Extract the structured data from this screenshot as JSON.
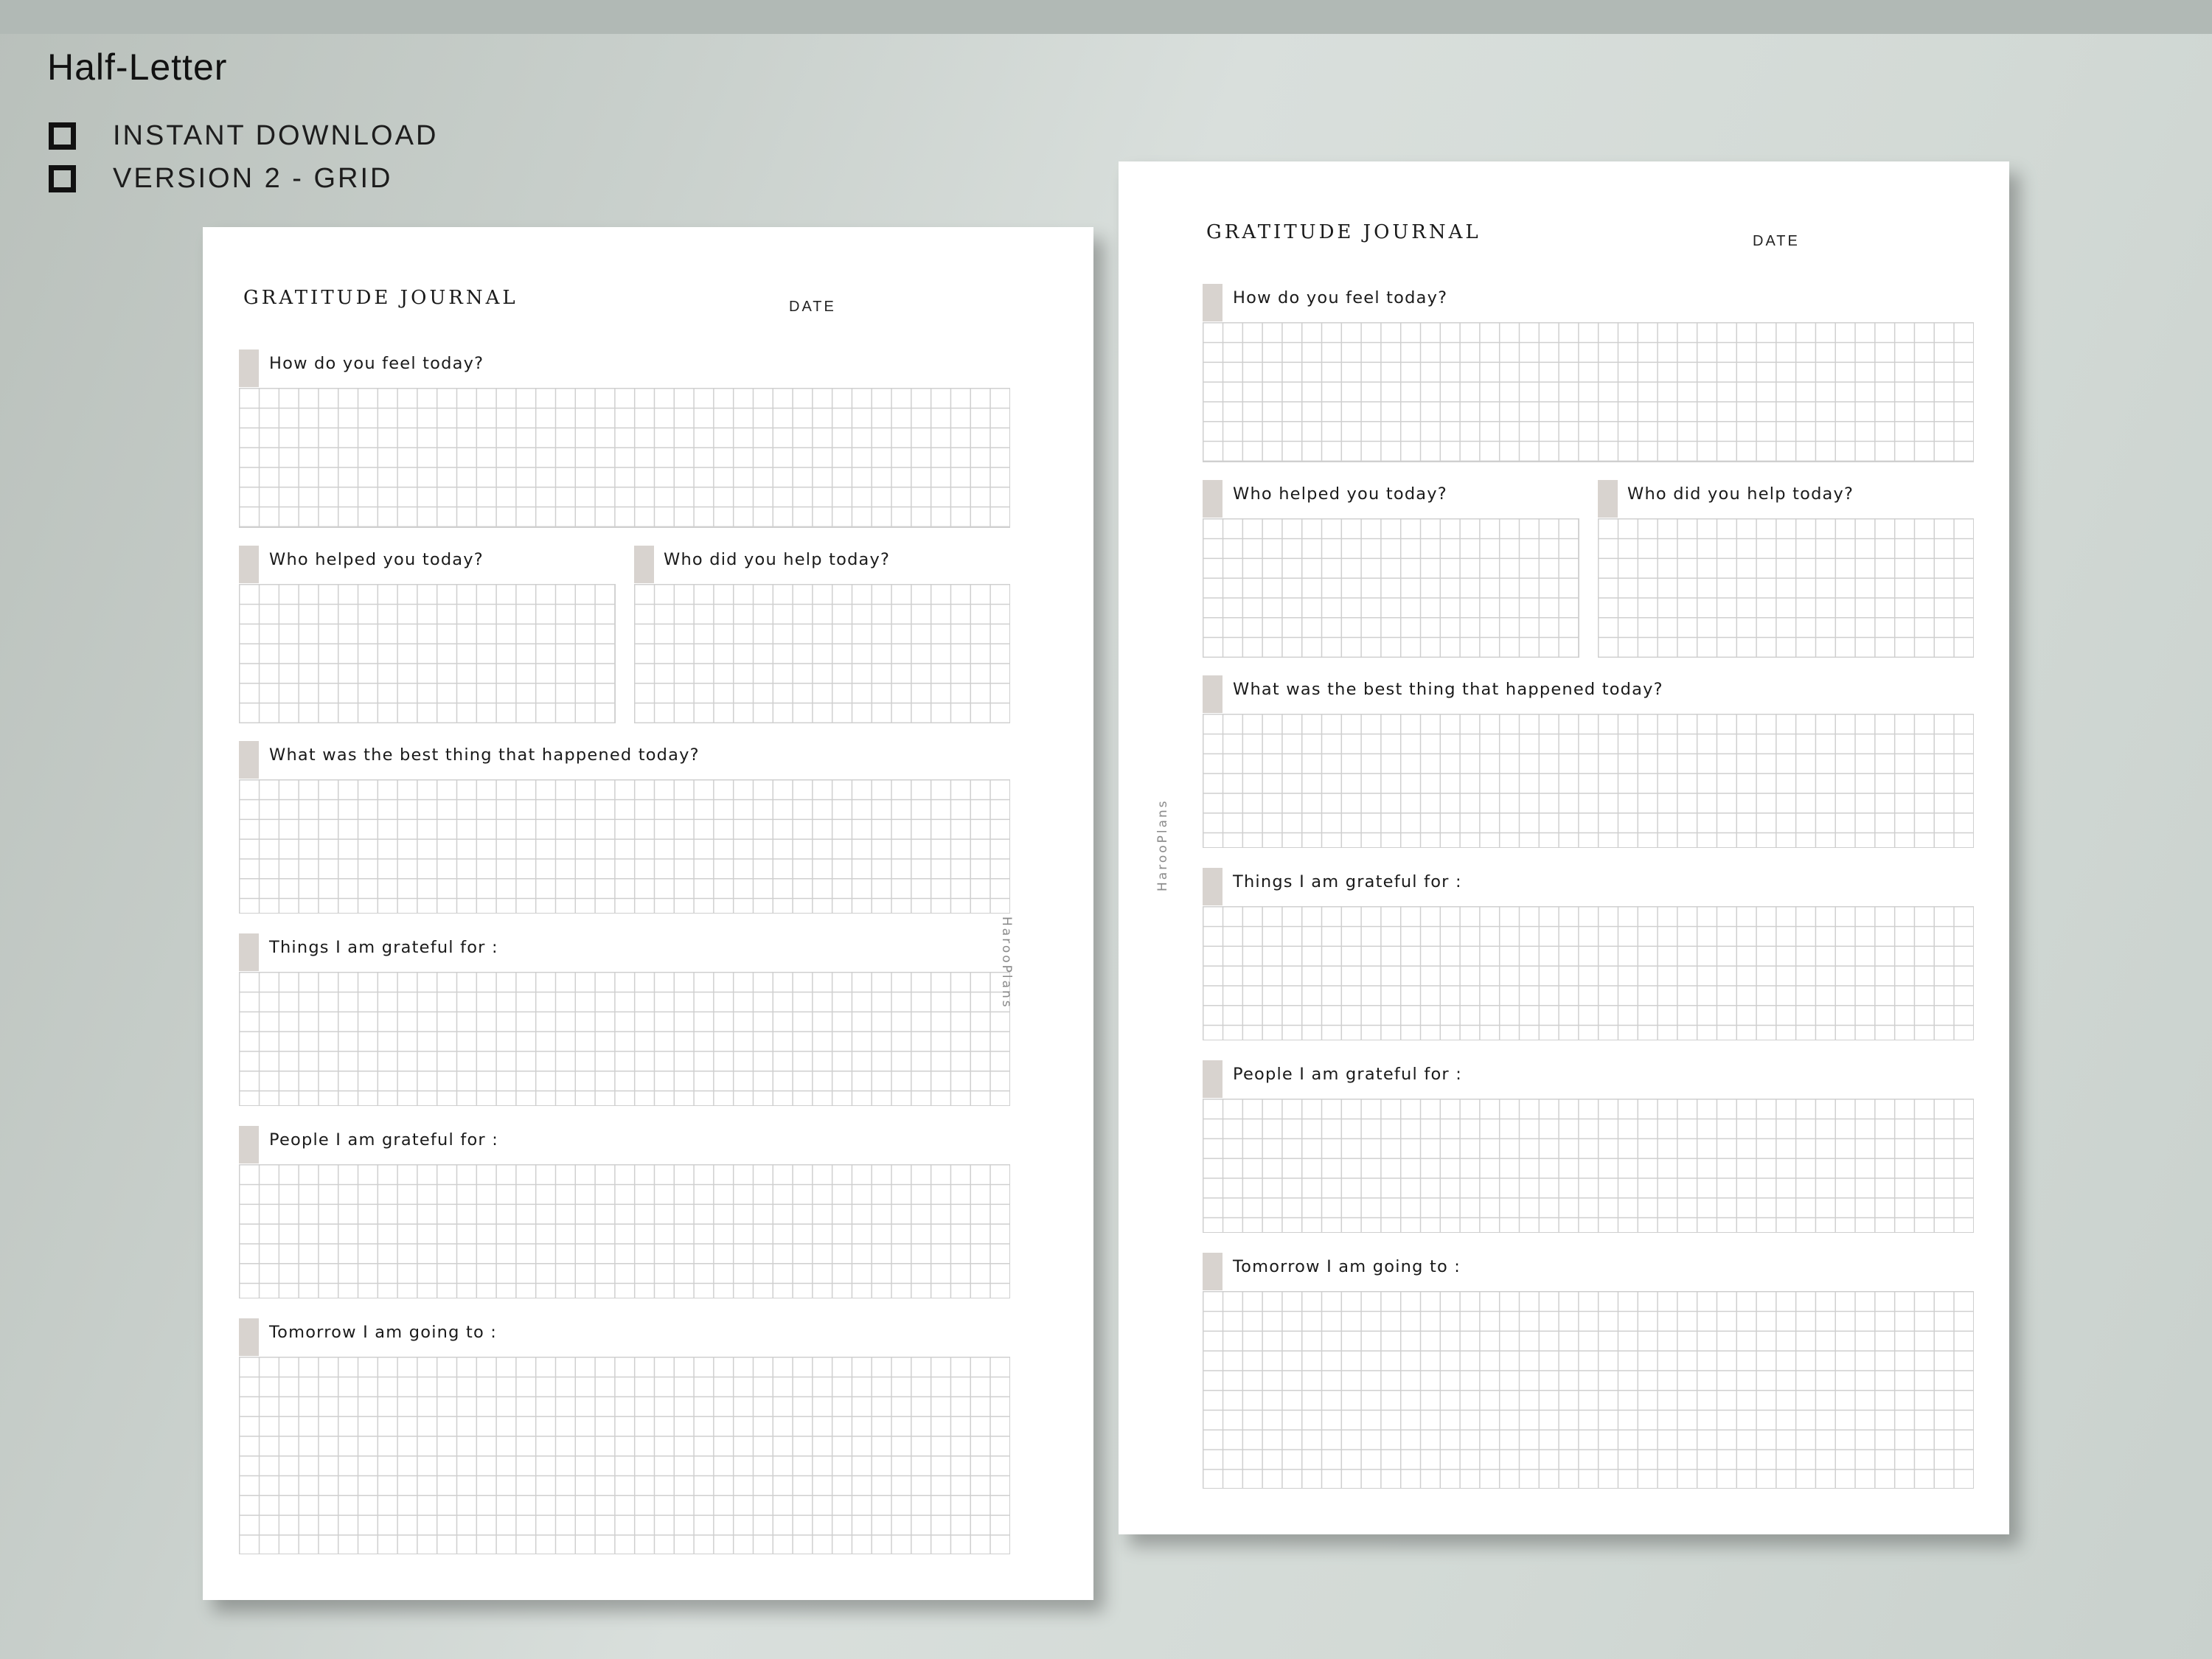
{
  "header": {
    "title": "Half-Letter",
    "features": [
      "INSTANT DOWNLOAD",
      "VERSION 2 - GRID"
    ]
  },
  "journal": {
    "title": "GRATITUDE JOURNAL",
    "date_label": "DATE",
    "brand": "HarooPlans",
    "questions": {
      "feel": "How do you feel today?",
      "helped_you": "Who helped you today?",
      "you_helped": "Who did you help today?",
      "best_thing": "What was the best thing that happened today?",
      "things_grateful": "Things I am grateful for :",
      "people_grateful": "People I am grateful for :",
      "tomorrow": "Tomorrow I am going to :"
    }
  }
}
